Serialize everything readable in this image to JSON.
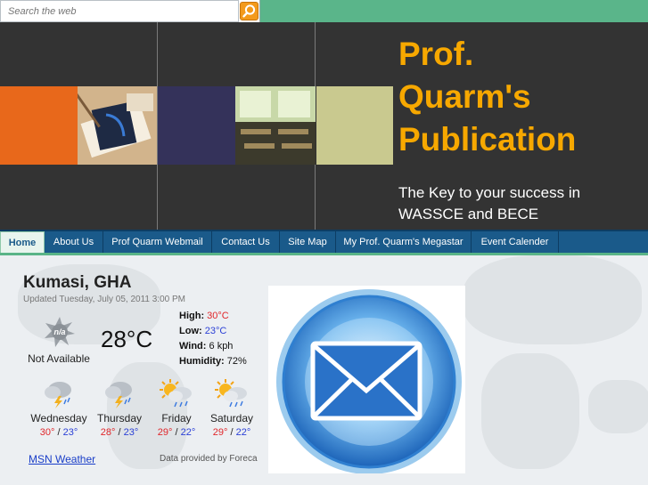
{
  "search": {
    "placeholder": "Search the web"
  },
  "header": {
    "title_line1": "Prof.",
    "title_line2": "Quarm's",
    "title_line3": "Publication",
    "tagline": "The Key to your success in WASSCE and BECE"
  },
  "nav": {
    "items": [
      {
        "label": "Home"
      },
      {
        "label": "About Us"
      },
      {
        "label": "Prof Quarm Webmail"
      },
      {
        "label": "Contact Us"
      },
      {
        "label": "Site Map"
      },
      {
        "label": "My Prof. Quarm's Megastar"
      },
      {
        "label": "Event Calender"
      }
    ]
  },
  "weather": {
    "city": "Kumasi, GHA",
    "updated": "Updated Tuesday, July 05, 2011 3:00 PM",
    "current_icon": "na-icon",
    "current_condition": "Not Available",
    "temperature": "28°C",
    "high_label": "High:",
    "high": "30°C",
    "low_label": "Low:",
    "low": "23°C",
    "wind_label": "Wind:",
    "wind": "6 kph",
    "humidity_label": "Humidity:",
    "humidity": "72%",
    "forecast": [
      {
        "day": "Wednesday",
        "high": "30°",
        "low": "23°",
        "icon": "thunderstorm-icon"
      },
      {
        "day": "Thursday",
        "high": "28°",
        "low": "23°",
        "icon": "thunderstorm-icon"
      },
      {
        "day": "Friday",
        "high": "29°",
        "low": "22°",
        "icon": "sun-showers-icon"
      },
      {
        "day": "Saturday",
        "high": "29°",
        "low": "22°",
        "icon": "sun-showers-icon"
      }
    ],
    "link_label": "MSN Weather",
    "provider": "Data provided by Foreca",
    "separator": "/"
  },
  "colors": {
    "accent_orange": "#f7a800",
    "nav_blue": "#1a5a8a",
    "top_green": "#5ab58a",
    "high_red": "#e0262a",
    "low_blue": "#2a3fd6"
  }
}
